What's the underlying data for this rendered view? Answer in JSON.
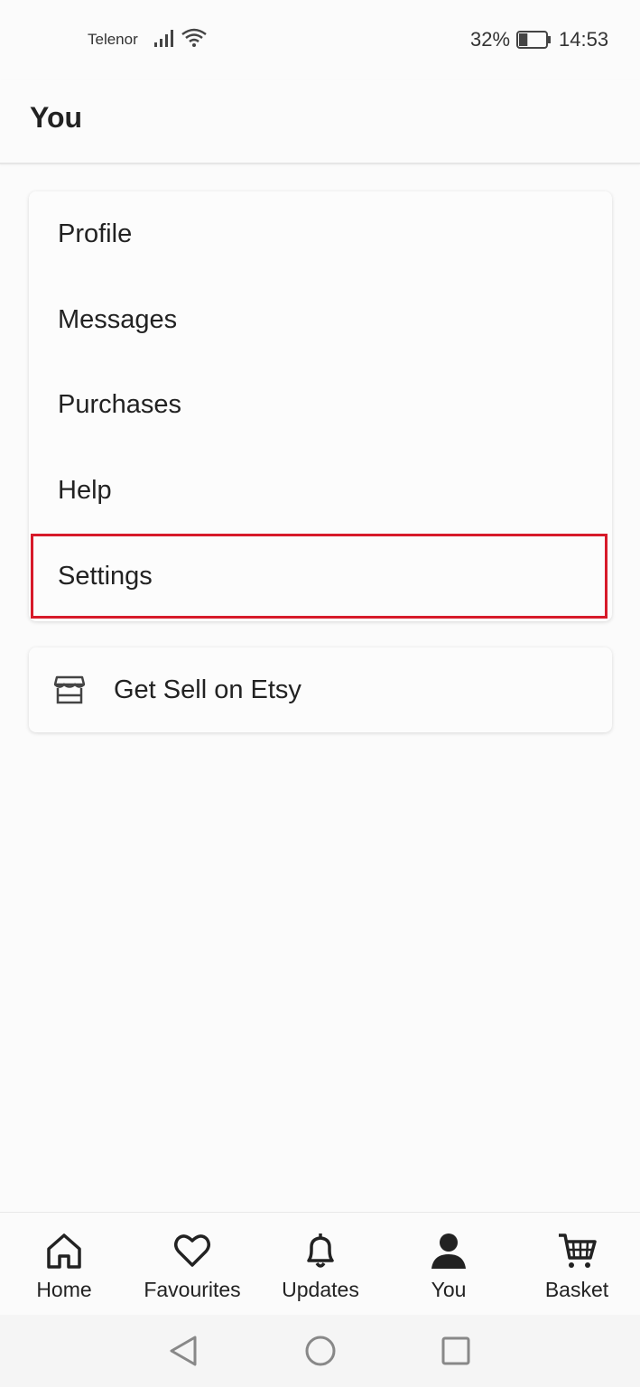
{
  "status_bar": {
    "carrier": "Telenor",
    "battery_percent": "32%",
    "time": "14:53",
    "battery_level": 0.32
  },
  "header": {
    "title": "You"
  },
  "menu": {
    "items": [
      {
        "label": "Profile"
      },
      {
        "label": "Messages"
      },
      {
        "label": "Purchases"
      },
      {
        "label": "Help"
      },
      {
        "label": "Settings"
      }
    ],
    "highlight_color": "#d71a2a"
  },
  "sell": {
    "label": "Get Sell on Etsy",
    "icon": "shop-icon"
  },
  "bottom_nav": {
    "tabs": [
      {
        "label": "Home",
        "icon": "home-icon"
      },
      {
        "label": "Favourites",
        "icon": "heart-icon"
      },
      {
        "label": "Updates",
        "icon": "bell-icon"
      },
      {
        "label": "You",
        "icon": "person-icon",
        "active": true
      },
      {
        "label": "Basket",
        "icon": "cart-icon"
      }
    ]
  },
  "system_nav": {
    "buttons": [
      "back",
      "home",
      "recents"
    ]
  }
}
